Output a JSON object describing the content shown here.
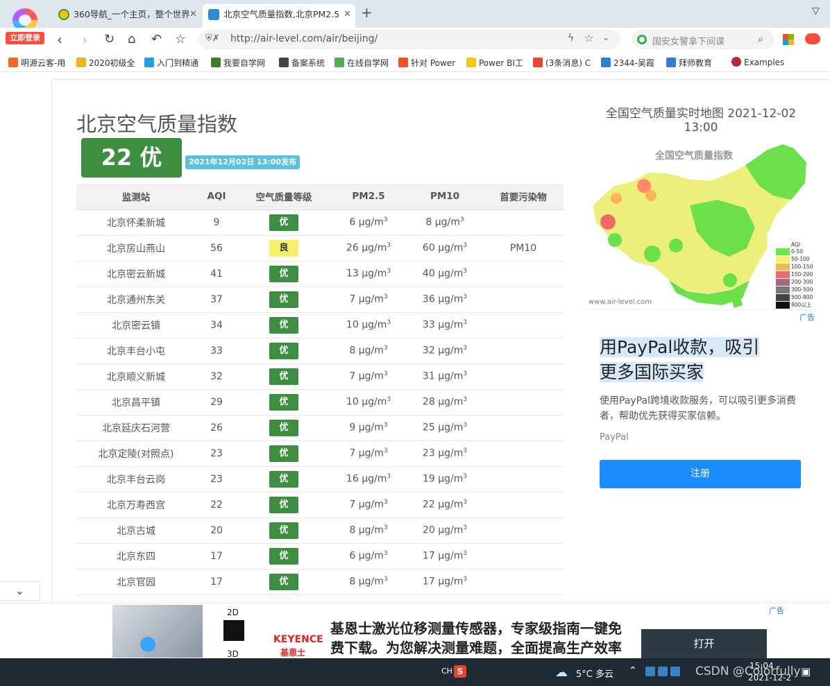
{
  "browser": {
    "login_badge": "立即登录",
    "tabs": [
      {
        "title": "360导航_一个主页，整个世界"
      },
      {
        "title": "北京空气质量指数,北京PM2.5"
      }
    ],
    "address": "http://air-level.com/air/beijing/",
    "search_placeholder": "国安女警拿下间谍",
    "bookmarks": [
      "明源云客-用",
      "2020初级全",
      "入门到精通",
      "我要自学网",
      "备案系统",
      "在线自学网",
      "针对 Power",
      "Power BI工",
      "(3条消息) C",
      "2344-吴霞",
      "拜师教育",
      "Examples"
    ]
  },
  "page": {
    "title": "北京空气质量指数",
    "aqi_badge": "22 优",
    "published": "2021年12月02日 13:00发布",
    "table": {
      "headers": [
        "监测站",
        "AQI",
        "空气质量等级",
        "PM2.5",
        "PM10",
        "首要污染物"
      ],
      "unit": "μg/m",
      "rows": [
        {
          "station": "北京怀柔新城",
          "aqi": "9",
          "level": "优",
          "pm25": "6",
          "pm10": "8",
          "primary": ""
        },
        {
          "station": "北京房山燕山",
          "aqi": "56",
          "level": "良",
          "pm25": "26",
          "pm10": "60",
          "primary": "PM10"
        },
        {
          "station": "北京密云新城",
          "aqi": "41",
          "level": "优",
          "pm25": "13",
          "pm10": "40",
          "primary": ""
        },
        {
          "station": "北京通州东关",
          "aqi": "37",
          "level": "优",
          "pm25": "7",
          "pm10": "36",
          "primary": ""
        },
        {
          "station": "北京密云镇",
          "aqi": "34",
          "level": "优",
          "pm25": "10",
          "pm10": "33",
          "primary": ""
        },
        {
          "station": "北京丰台小屯",
          "aqi": "33",
          "level": "优",
          "pm25": "8",
          "pm10": "32",
          "primary": ""
        },
        {
          "station": "北京顺义新城",
          "aqi": "32",
          "level": "优",
          "pm25": "7",
          "pm10": "31",
          "primary": ""
        },
        {
          "station": "北京昌平镇",
          "aqi": "29",
          "level": "优",
          "pm25": "10",
          "pm10": "28",
          "primary": ""
        },
        {
          "station": "北京延庆石河营",
          "aqi": "26",
          "level": "优",
          "pm25": "9",
          "pm10": "25",
          "primary": ""
        },
        {
          "station": "北京定陵(对照点)",
          "aqi": "23",
          "level": "优",
          "pm25": "7",
          "pm10": "23",
          "primary": ""
        },
        {
          "station": "北京丰台云岗",
          "aqi": "23",
          "level": "优",
          "pm25": "16",
          "pm10": "19",
          "primary": ""
        },
        {
          "station": "北京万寿西宫",
          "aqi": "22",
          "level": "优",
          "pm25": "7",
          "pm10": "22",
          "primary": ""
        },
        {
          "station": "北京古城",
          "aqi": "20",
          "level": "优",
          "pm25": "8",
          "pm10": "20",
          "primary": ""
        },
        {
          "station": "北京东四",
          "aqi": "17",
          "level": "优",
          "pm25": "6",
          "pm10": "17",
          "primary": ""
        },
        {
          "station": "北京官园",
          "aqi": "17",
          "level": "优",
          "pm25": "8",
          "pm10": "17",
          "primary": ""
        }
      ]
    },
    "map": {
      "title": "全国空气质量实时地图 2021-12-02 13:00",
      "inner_title": "全国空气质量指数",
      "watermark": "www.air-level.com",
      "legend_title": "AQI",
      "legend": [
        {
          "label": "0-50",
          "color": "#66e94a"
        },
        {
          "label": "50-100",
          "color": "#f5f36a"
        },
        {
          "label": "100-150",
          "color": "#ffb45a"
        },
        {
          "label": "150-200",
          "color": "#f06a6a"
        },
        {
          "label": "200-300",
          "color": "#a9667a"
        },
        {
          "label": "300-500",
          "color": "#777777"
        },
        {
          "label": "500-800",
          "color": "#444444"
        },
        {
          "label": "800以上",
          "color": "#111111"
        }
      ]
    },
    "side_ad": {
      "tag": "广告",
      "headline_1": "用PayPal收款，吸引",
      "headline_2": "更多国际买家",
      "body": "使用PayPal跨境收款服务，可以吸引更多消费者，帮助优先获得买家信赖。",
      "brand": "PayPal",
      "cta": "注册"
    },
    "bottom_ad": {
      "tag": "广告",
      "label_2d": "2D",
      "label_3d": "3D",
      "brand": "KEYENCE",
      "brand_sub": "基恩士",
      "headline": "基恩士激光位移测量传感器，专家级指南一键免费下载。为您解决测量难题，全面提高生产效率",
      "button": "打开"
    }
  },
  "taskbar": {
    "ime": "CH",
    "weather": "5°C 多云",
    "watermark": "CSDN @Colorfully",
    "time": "15:04",
    "date": "2021-12-2"
  },
  "colors": {
    "good": "#3e8e41",
    "moderate": "#f6ef6a",
    "publish_badge": "#5bc0de",
    "cta": "#1a8cff"
  }
}
